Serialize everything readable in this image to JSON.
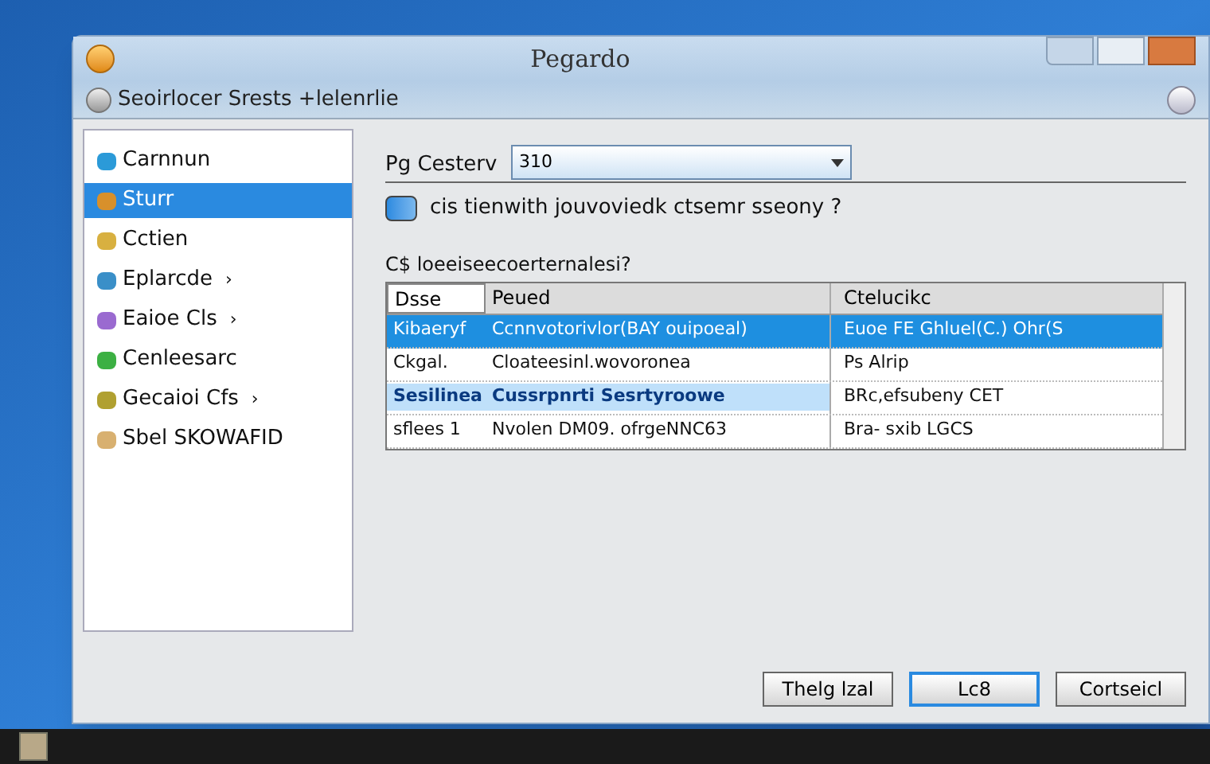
{
  "window": {
    "title": "Pegardo",
    "address": "Seoirlocer Srests +lelenrlie"
  },
  "sidebar": {
    "items": [
      {
        "label": "Carnnun",
        "selected": false,
        "color": "#2b9ad8"
      },
      {
        "label": "Sturr",
        "selected": true,
        "color": "#d8902b"
      },
      {
        "label": "Cctien",
        "selected": false,
        "color": "#d8b040"
      },
      {
        "label": "Eplarcde",
        "selected": false,
        "color": "#3a8fc8",
        "suffix": "›"
      },
      {
        "label": "Eaioe Cls",
        "selected": false,
        "color": "#9a6ad0",
        "suffix": "›"
      },
      {
        "label": "Cenleesarc",
        "selected": false,
        "color": "#3cb043"
      },
      {
        "label": "Gecaioi Cfs",
        "selected": false,
        "color": "#b0a030",
        "suffix": "›"
      },
      {
        "label": "Sbel SKOWAFID",
        "selected": false,
        "color": "#d8b070"
      }
    ]
  },
  "profile": {
    "label": "Pg Cesterv",
    "value": "310"
  },
  "option": {
    "label": "cis tienwith jouvoviedk ctsemr sseony ?",
    "checked": true
  },
  "list_label": "C$ loeeiseecoerternalesi?",
  "table": {
    "columns": [
      "Dsse",
      "Peued",
      "Ctelucikc"
    ],
    "rows": [
      {
        "selected": true,
        "highlighted": false,
        "cells": [
          "Kibaeryf",
          "Ccnnvotorivlor(BAY ouipoeal)",
          "Euoe FE Ghluel(C.) Ohr(S"
        ]
      },
      {
        "selected": false,
        "highlighted": false,
        "cells": [
          "Ckgal.",
          "Cloateesinl.wovoroneа",
          "Ps Alrip"
        ]
      },
      {
        "selected": false,
        "highlighted": true,
        "cells": [
          "Sesilinea",
          "Cussrpnrti  Sesrtyroowe",
          "BRc,efsubeny CET"
        ]
      },
      {
        "selected": false,
        "highlighted": false,
        "cells": [
          "sflees 1",
          "Nvolen DM09. ofrgeNNC63",
          "Bra- sxib LGCS"
        ]
      }
    ]
  },
  "buttons": [
    {
      "label": "Thelg lzal",
      "default": false
    },
    {
      "label": "Lc8",
      "default": true
    },
    {
      "label": "Cortseicl",
      "default": false
    }
  ]
}
